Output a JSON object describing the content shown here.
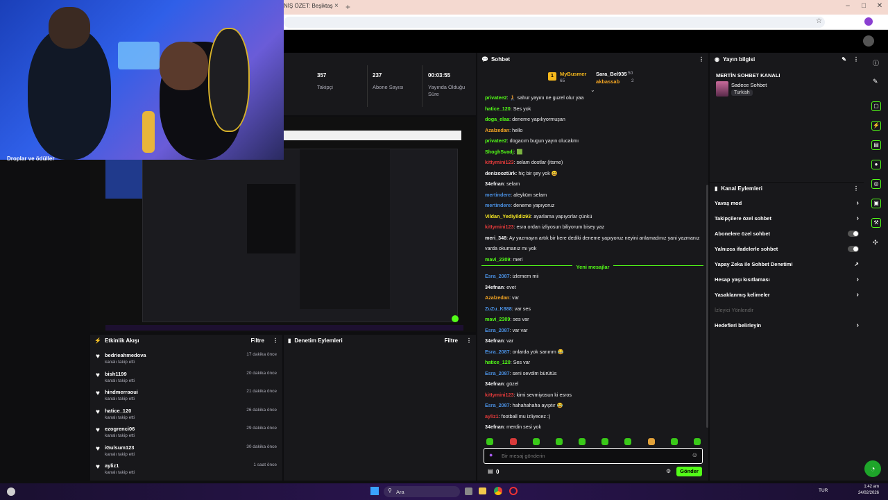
{
  "browser": {
    "tab_title": "NİŞ ÖZET: Beşiktaş",
    "tab_close": "×",
    "new_tab": "+",
    "win_min": "–",
    "win_max": "□",
    "win_close": "✕"
  },
  "stats": [
    {
      "value": "357",
      "label": "Takipçi"
    },
    {
      "value": "237",
      "label": "Abone Sayısı"
    },
    {
      "value": "00:03:55",
      "label": "Yayında Olduğu Süre"
    }
  ],
  "preview": {
    "label": "Droplar ve ödüller"
  },
  "activity": {
    "title": "Etkinlik Akışı",
    "filter": "Filtre",
    "items": [
      {
        "name": "bedrieahmedova",
        "sub": "kanalı takip etti",
        "time": "17 dakika önce"
      },
      {
        "name": "bish1199",
        "sub": "kanalı takip etti",
        "time": "20 dakika önce"
      },
      {
        "name": "hindmerraoui",
        "sub": "kanalı takip etti",
        "time": "21 dakika önce"
      },
      {
        "name": "hatice_120",
        "sub": "kanalı takip etti",
        "time": "26 dakika önce"
      },
      {
        "name": "ezogrenci06",
        "sub": "kanalı takip etti",
        "time": "29 dakika önce"
      },
      {
        "name": "iGulsum123",
        "sub": "kanalı takip etti",
        "time": "30 dakika önce"
      },
      {
        "name": "ayliz1",
        "sub": "kanalı takip etti",
        "time": "1 saat önce"
      }
    ]
  },
  "moderation": {
    "title": "Denetim Eylemleri",
    "filter": "Filtre"
  },
  "chat": {
    "title": "Sohbet",
    "top_gifters": [
      {
        "name": "MyBusmer",
        "count": "65"
      },
      {
        "name": "Sara_Bel935",
        "count": "50"
      },
      {
        "name": "akbassab",
        "count": "2"
      }
    ],
    "new_messages_label": "Yeni mesajlar",
    "messages_before": [
      {
        "user": "privatee2",
        "color": "#53fc18",
        "text": "🧎 sahur yayını ne guzel olur yaa"
      },
      {
        "user": "hatice_120",
        "color": "#53fc18",
        "text": "Ses yok"
      },
      {
        "user": "doga_elaa",
        "color": "#53fc18",
        "text": "deneme yapılıyormuşan"
      },
      {
        "user": "Azalzedan",
        "color": "#f5a623",
        "text": "hello"
      },
      {
        "user": "privatee2",
        "color": "#53fc18",
        "text": "dogacım bugun yayın olucakmı"
      },
      {
        "user": "ShoghSvadj",
        "color": "#53fc18",
        "text": "🟩"
      },
      {
        "user": "kittymini123",
        "color": "#e03a3a",
        "text": "selam dostlar (itsme)"
      },
      {
        "user": "denizooztürk",
        "color": "#efeff1",
        "text": "hiç bir şey yok 😀"
      },
      {
        "user": "34efnan",
        "color": "#efeff1",
        "text": "selam"
      },
      {
        "user": "mertindere",
        "color": "#4a90e2",
        "text": "aleyküm selam"
      },
      {
        "user": "mertindere",
        "color": "#4a90e2",
        "text": "deneme yapıyoruz"
      },
      {
        "user": "Vildan_Yediyildiz93",
        "color": "#f5e623",
        "text": "ayarlama yapıyorlar çünkü"
      },
      {
        "user": "kittymini123",
        "color": "#e03a3a",
        "text": "esra ordan izliyosun biliyorum bisey yaz"
      },
      {
        "user": "meri_348",
        "color": "#efeff1",
        "text": "Ay yazmayın artık bir kere dediki deneme yapıyoruz neyini anlamadınız yani yazmanız"
      },
      {
        "user": "",
        "color": "#efeff1",
        "text": "varda okumanız mı yok"
      },
      {
        "user": "mavi_2309",
        "color": "#53fc18",
        "text": "meri"
      }
    ],
    "messages_after": [
      {
        "user": "Esra_2087",
        "color": "#4a90e2",
        "text": "izlemem mii"
      },
      {
        "user": "34efnan",
        "color": "#efeff1",
        "text": "evet"
      },
      {
        "user": "Azalzedan",
        "color": "#f5a623",
        "text": "var"
      },
      {
        "user": "ZuZu_K888",
        "color": "#4a90e2",
        "text": "var ses"
      },
      {
        "user": "mavi_2309",
        "color": "#53fc18",
        "text": "ses var"
      },
      {
        "user": "Esra_2087",
        "color": "#4a90e2",
        "text": "var var"
      },
      {
        "user": "34efnan",
        "color": "#efeff1",
        "text": "var"
      },
      {
        "user": "Esra_2087",
        "color": "#4a90e2",
        "text": "onlarda yok sanırım 😂"
      },
      {
        "user": "hatice_120",
        "color": "#53fc18",
        "text": "Ses var"
      },
      {
        "user": "Esra_2087",
        "color": "#4a90e2",
        "text": "seni sevdim bürütüs"
      },
      {
        "user": "34efnan",
        "color": "#efeff1",
        "text": "güzel"
      },
      {
        "user": "kittymini123",
        "color": "#e03a3a",
        "text": "kimi sevmiyosun ki esros"
      },
      {
        "user": "Esra_2087",
        "color": "#4a90e2",
        "text": "hahahahaha ayıptır 😂"
      },
      {
        "user": "ayliz1",
        "color": "#e03a3a",
        "text": "football mu izliyecez :)"
      },
      {
        "user": "34efnan",
        "color": "#efeff1",
        "text": "merdin sesi yok"
      }
    ],
    "input_placeholder": "Bir mesaj gönderin",
    "points": "0",
    "send_label": "Gönder"
  },
  "stream_info": {
    "title": "Yayın bilgisi",
    "channel_name": "MERTİN SOHBET KANALI",
    "category": "Sadece Sohbet",
    "tag": "Turkish"
  },
  "channel_actions": {
    "title": "Kanal Eylemleri",
    "items": [
      {
        "label": "Yavaş mod",
        "control": "chevron"
      },
      {
        "label": "Takipçilere özel sohbet",
        "control": "chevron"
      },
      {
        "label": "Abonelere özel sohbet",
        "control": "toggle"
      },
      {
        "label": "Yalnızca ifadelerle sohbet",
        "control": "toggle"
      },
      {
        "label": "Yapay Zeka ile Sohbet Denetimi",
        "control": "external"
      },
      {
        "label": "Hesap yaşı kısıtlaması",
        "control": "chevron"
      },
      {
        "label": "Yasaklanmış kelimeler",
        "control": "chevron"
      },
      {
        "label": "İzleyici Yönlendir",
        "control": "none"
      },
      {
        "label": "Hedefleri belirleyin",
        "control": "chevron"
      }
    ]
  },
  "taskbar": {
    "search_placeholder": "Ara",
    "lang": "TUR",
    "time": "1:42 am",
    "date": "24/02/2026"
  },
  "colors": {
    "accent": "#53fc18",
    "panel": "#18181b",
    "bg": "#0e0e10"
  }
}
